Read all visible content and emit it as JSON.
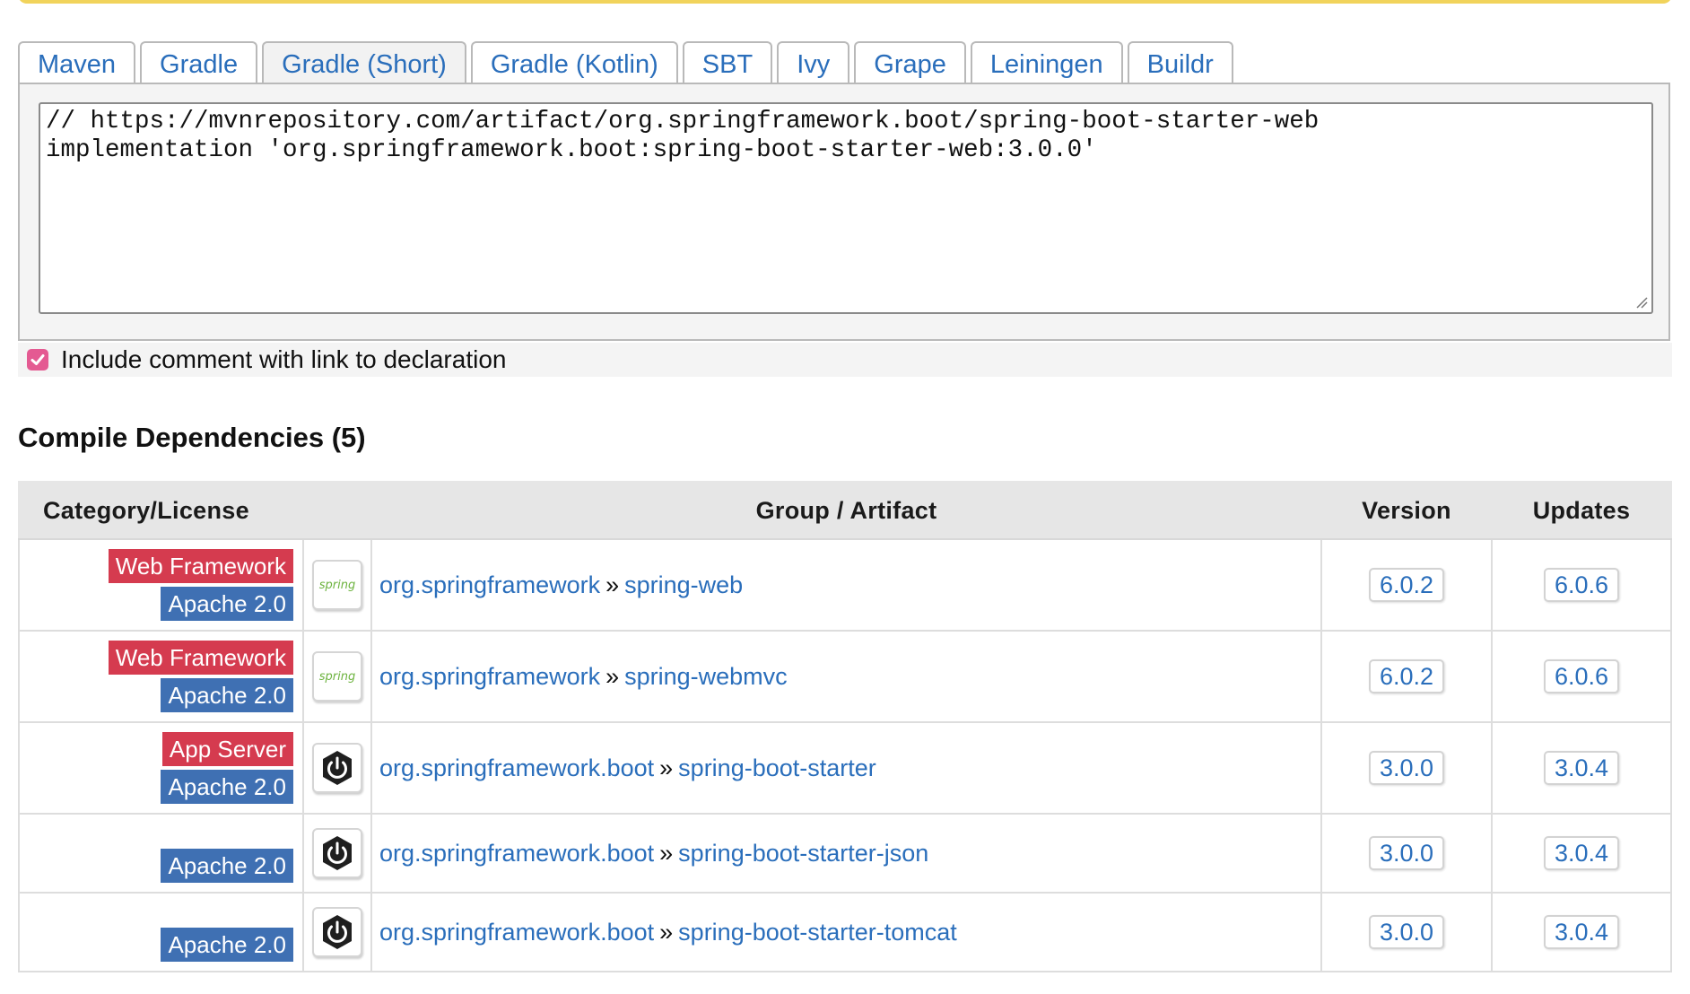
{
  "tabs": [
    "Maven",
    "Gradle",
    "Gradle (Short)",
    "Gradle (Kotlin)",
    "SBT",
    "Ivy",
    "Grape",
    "Leiningen",
    "Buildr"
  ],
  "active_tab": "Gradle (Short)",
  "code": {
    "line1": "// https://mvnrepository.com/artifact/org.springframework.boot/spring-boot-starter-web",
    "line2": "implementation 'org.springframework.boot:spring-boot-starter-web:3.0.0'"
  },
  "include_comment": {
    "checked": true,
    "label": "Include comment with link to declaration"
  },
  "section_title": "Compile Dependencies (5)",
  "table": {
    "headers": {
      "category": "Category/License",
      "artifact": "Group / Artifact",
      "version": "Version",
      "updates": "Updates"
    },
    "separator": "»",
    "rows": [
      {
        "category": "Web Framework",
        "license": "Apache 2.0",
        "logo": "spring-logo",
        "logo_text": "spring",
        "group": "org.springframework",
        "artifact": "spring-web",
        "version": "6.0.2",
        "update": "6.0.6"
      },
      {
        "category": "Web Framework",
        "license": "Apache 2.0",
        "logo": "spring-logo",
        "logo_text": "spring",
        "group": "org.springframework",
        "artifact": "spring-webmvc",
        "version": "6.0.2",
        "update": "6.0.6"
      },
      {
        "category": "App Server",
        "license": "Apache 2.0",
        "logo": "power-icon",
        "group": "org.springframework.boot",
        "artifact": "spring-boot-starter",
        "version": "3.0.0",
        "update": "3.0.4"
      },
      {
        "category": "",
        "license": "Apache 2.0",
        "logo": "power-icon",
        "group": "org.springframework.boot",
        "artifact": "spring-boot-starter-json",
        "version": "3.0.0",
        "update": "3.0.4"
      },
      {
        "category": "",
        "license": "Apache 2.0",
        "logo": "power-icon",
        "group": "org.springframework.boot",
        "artifact": "spring-boot-starter-tomcat",
        "version": "3.0.0",
        "update": "3.0.4"
      }
    ]
  },
  "colors": {
    "category_badge": "#d53b4f",
    "license_badge": "#3f70b3",
    "link": "#2a6ebb",
    "checkbox": "#e45a92",
    "spring_green": "#6db33f"
  }
}
